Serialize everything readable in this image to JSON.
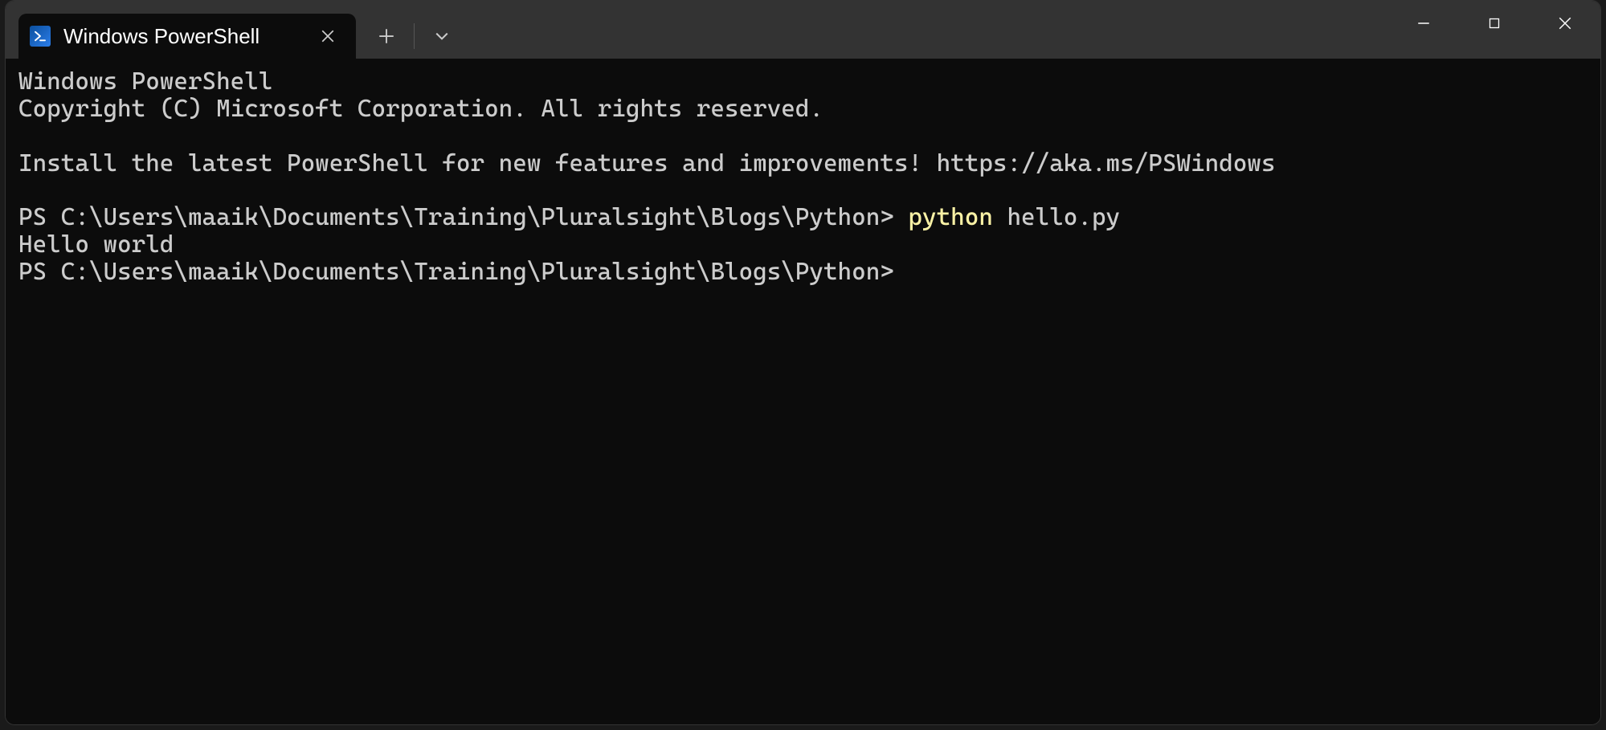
{
  "tab": {
    "title": "Windows PowerShell",
    "icon_glyph": ">_"
  },
  "terminal": {
    "header_line1": "Windows PowerShell",
    "header_line2": "Copyright (C) Microsoft Corporation. All rights reserved.",
    "install_msg": "Install the latest PowerShell for new features and improvements! https://aka.ms/PSWindows",
    "prompt1_prefix": "PS C:\\Users\\maaik\\Documents\\Training\\Pluralsight\\Blogs\\Python> ",
    "command_exe": "python",
    "command_arg": " hello.py",
    "output1": "Hello world",
    "prompt2": "PS C:\\Users\\maaik\\Documents\\Training\\Pluralsight\\Blogs\\Python>"
  }
}
